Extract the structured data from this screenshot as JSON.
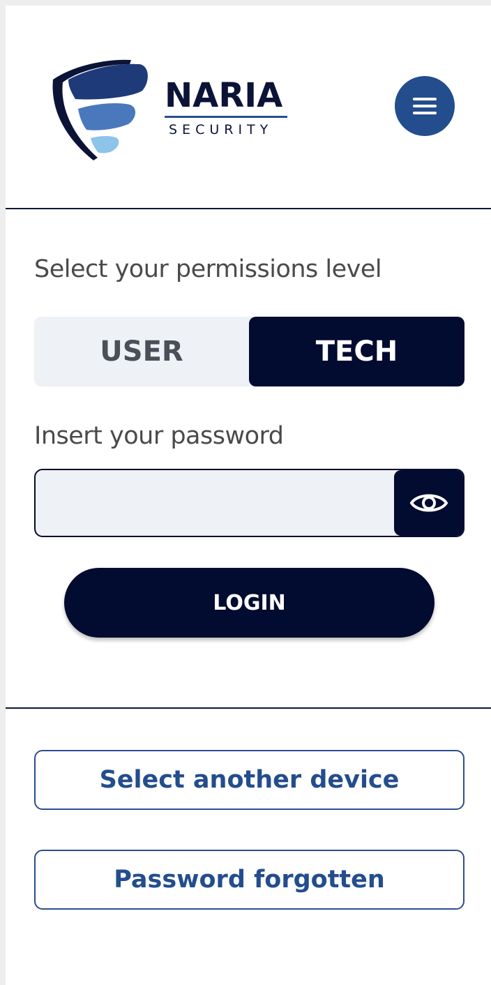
{
  "brand": {
    "name": "NARIA",
    "tagline": "SECURITY",
    "colors": {
      "navy": "#020b30",
      "brand_blue": "#234d8d",
      "mid_blue": "#4a78bd",
      "light_blue": "#8ec3ea"
    }
  },
  "header": {
    "menu_icon": "hamburger-menu-icon"
  },
  "permissions": {
    "label": "Select your permissions level",
    "options": [
      "USER",
      "TECH"
    ],
    "selected": "TECH"
  },
  "password": {
    "label": "Insert your password",
    "value": "",
    "placeholder": "",
    "toggle_icon": "eye-icon"
  },
  "actions": {
    "login_label": "LOGIN",
    "select_device_label": "Select another device",
    "forgot_password_label": "Password forgotten"
  }
}
